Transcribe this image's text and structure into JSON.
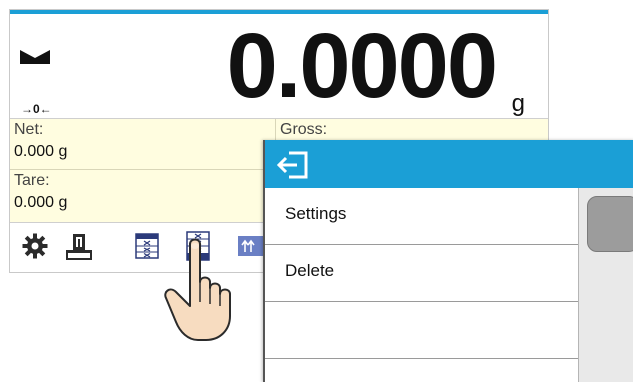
{
  "scale": {
    "weight": "0.0000",
    "unit": "g",
    "zero_indicator": "→0←",
    "net_label": "Net:",
    "net_value": "0.000 g",
    "gross_label": "Gross:",
    "tare_label": "Tare:",
    "tare_value": "0.000 g"
  },
  "toolbar": {
    "icons": [
      "gear-icon",
      "tare-weight-icon",
      "database-icon",
      "database-edit-icon",
      "arrows-icon"
    ]
  },
  "popup": {
    "exit_icon": "exit-icon",
    "items": [
      {
        "label": "Settings"
      },
      {
        "label": "Delete"
      },
      {
        "label": ""
      }
    ]
  },
  "colors": {
    "accent": "#1b9fd6",
    "info_panel": "#fffde0",
    "scroll_thumb": "#9c9c9c"
  }
}
